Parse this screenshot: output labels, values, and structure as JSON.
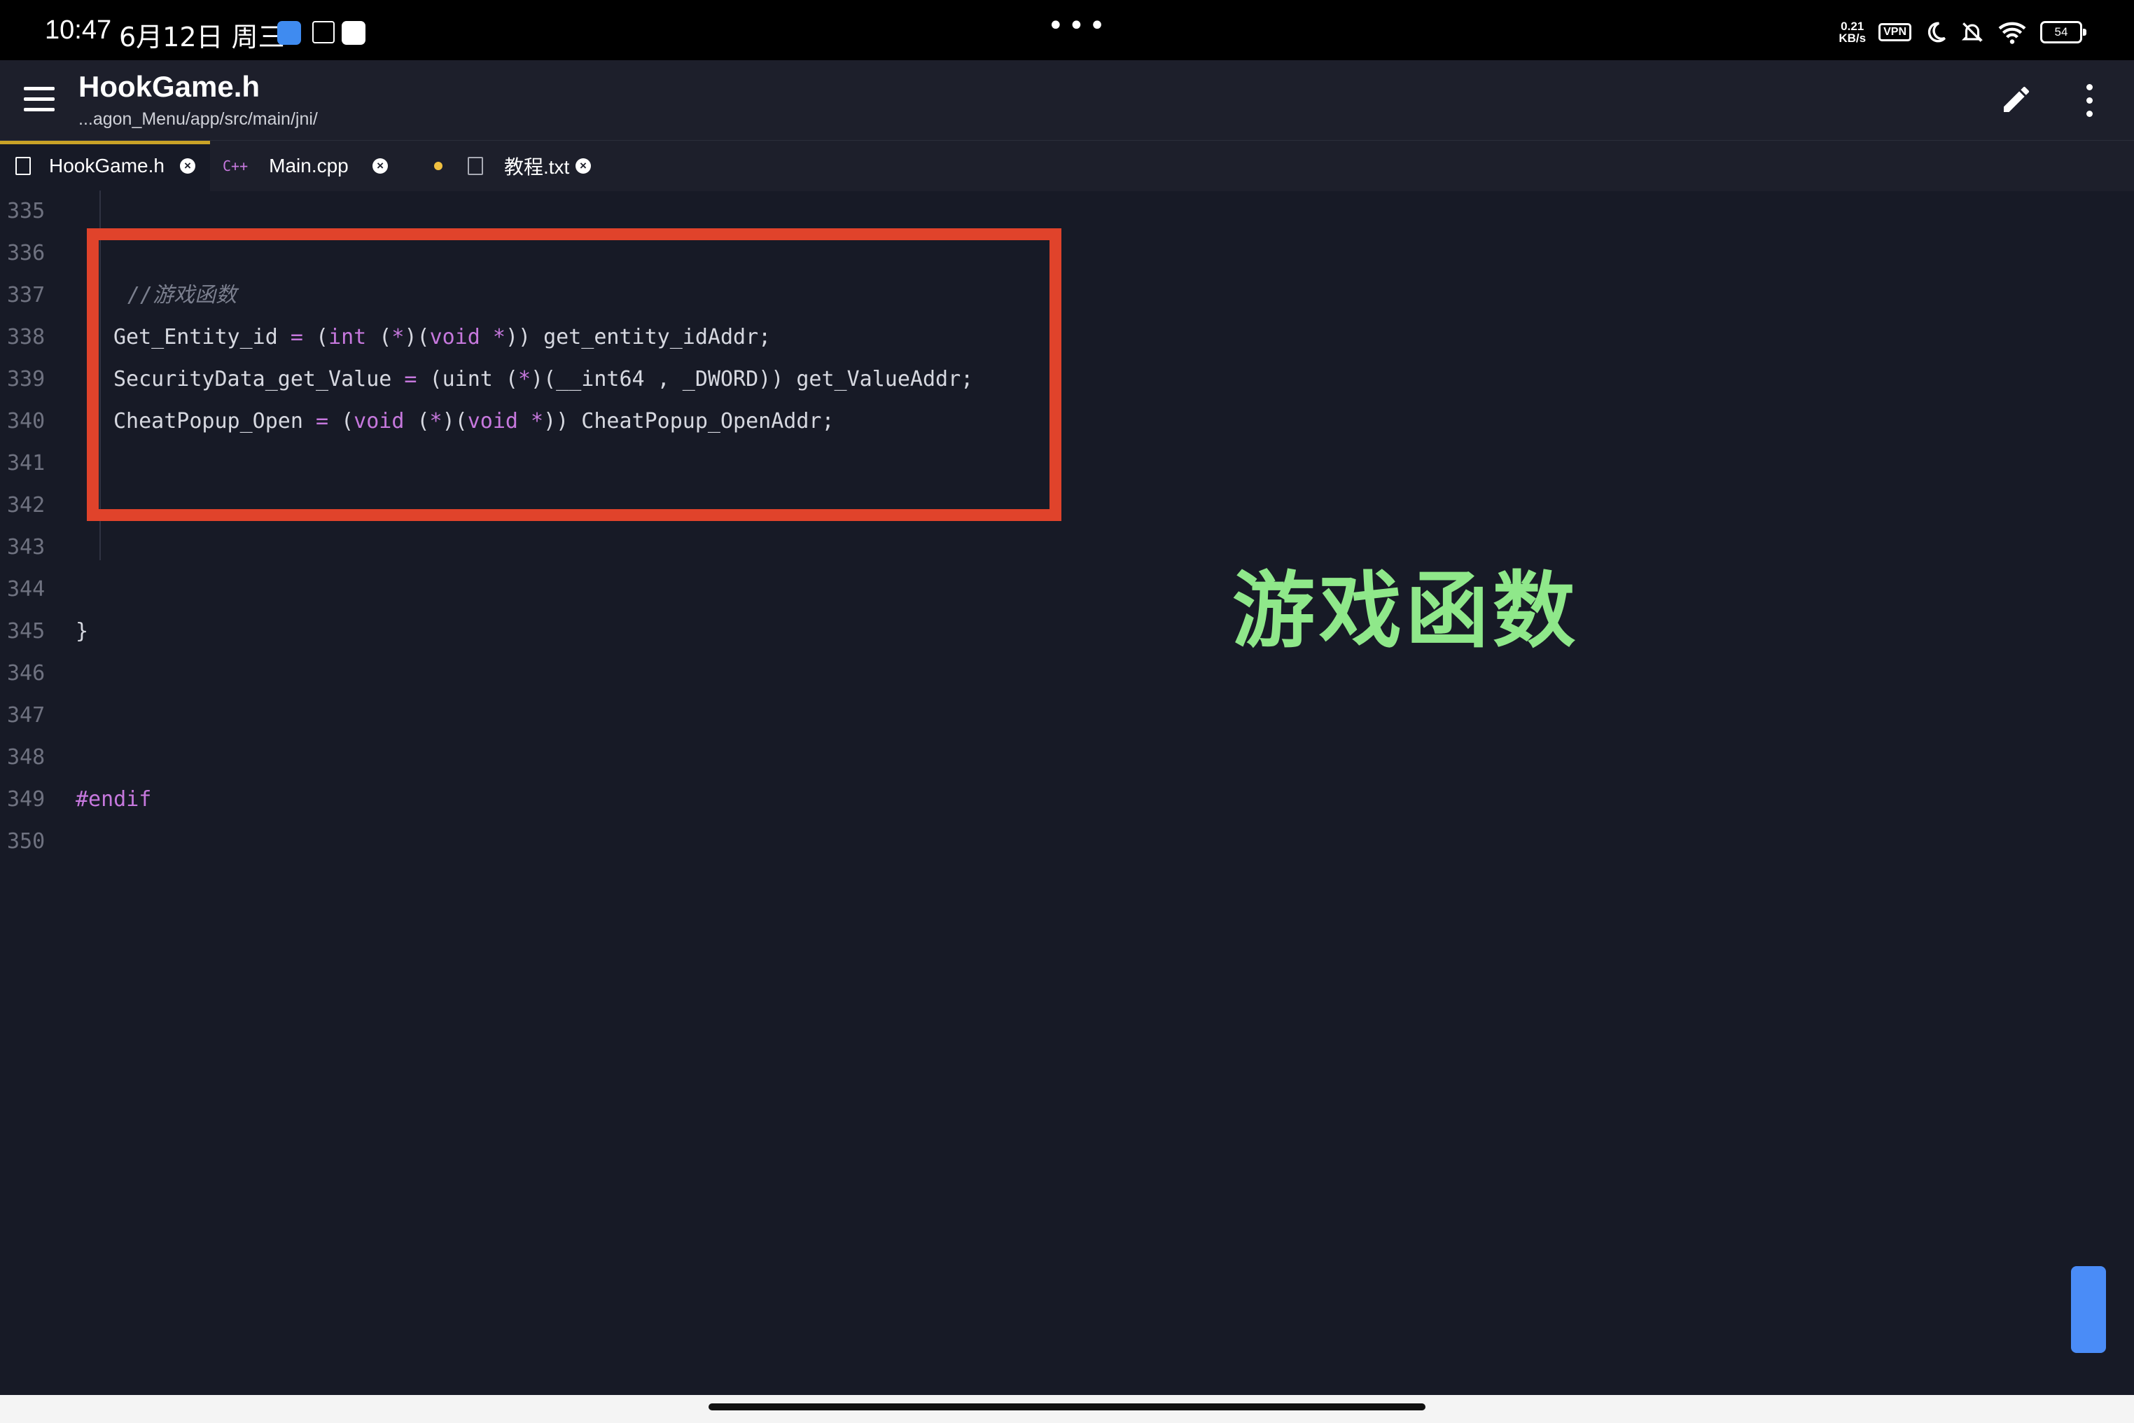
{
  "status_bar": {
    "time": "10:47",
    "date": "6月12日 周三",
    "dots": "•••",
    "net_speed_top": "0.21",
    "net_speed_bottom": "KB/s",
    "vpn": "VPN",
    "battery": "54"
  },
  "app_bar": {
    "title": "HookGame.h",
    "path": "...agon_Menu/app/src/main/jni/"
  },
  "tabs": [
    {
      "label": "HookGame.h",
      "close": "×"
    },
    {
      "label": "Main.cpp",
      "close": "×",
      "icon_text": "C++"
    },
    {
      "label": "教程.txt",
      "close": "×"
    }
  ],
  "editor": {
    "line_numbers": [
      "335",
      "336",
      "337",
      "338",
      "339",
      "340",
      "341",
      "342",
      "343",
      "344",
      "345",
      "346",
      "347",
      "348",
      "349",
      "350"
    ],
    "line337_comment": "//游戏函数",
    "line338": {
      "a": "Get_Entity_id ",
      "b": "=",
      "c": " (",
      "d": "int",
      "e": " (",
      "f": "*",
      "g": ")(",
      "h": "void",
      "i": " ",
      "j": "*",
      "k": ")) get_entity_idAddr;"
    },
    "line339": {
      "a": "SecurityData_get_Value ",
      "b": "=",
      "c": " (uint (",
      "d": "*",
      "e": ")(__int64 , _DWORD)) get_ValueAddr;"
    },
    "line340": {
      "a": "CheatPopup_Open ",
      "b": "=",
      "c": " (",
      "d": "void",
      "e": " (",
      "f": "*",
      "g": ")(",
      "h": "void",
      "i": " ",
      "j": "*",
      "k": ")) CheatPopup_OpenAddr;"
    },
    "line345": "}",
    "line349": "#endif"
  },
  "annotation_text": "游戏函数",
  "colors": {
    "background": "#171a26",
    "keyword": "#c678dd",
    "highlight_box": "#e0432b",
    "annotation": "#8fe88a",
    "scroll_handle": "#4a8cf7"
  }
}
